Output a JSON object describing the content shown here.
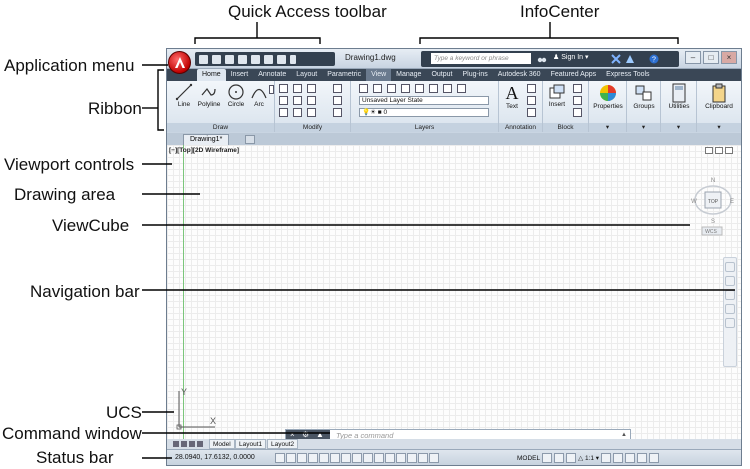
{
  "callouts": {
    "quick_access_toolbar": "Quick Access toolbar",
    "infocenter": "InfoCenter",
    "application_menu": "Application menu",
    "ribbon": "Ribbon",
    "viewport_controls": "Viewport controls",
    "drawing_area": "Drawing area",
    "viewcube": "ViewCube",
    "navigation_bar": "Navigation bar",
    "ucs": "UCS",
    "command_window": "Command window",
    "status_bar": "Status bar"
  },
  "titlebar": {
    "document_title": "Drawing1.dwg",
    "search_placeholder": "Type a keyword or phrase",
    "sign_in": "Sign In"
  },
  "ribbon_tabs": [
    "Home",
    "Insert",
    "Annotate",
    "Layout",
    "Parametric",
    "View",
    "Manage",
    "Output",
    "Plug-ins",
    "Autodesk 360",
    "Featured Apps",
    "Express Tools"
  ],
  "ribbon": {
    "draw": {
      "title": "Draw",
      "line": "Line",
      "polyline": "Polyline",
      "circle": "Circle",
      "arc": "Arc"
    },
    "modify": {
      "title": "Modify"
    },
    "layers": {
      "title": "Layers",
      "layer_state": "Unsaved Layer State",
      "current_layer": "0"
    },
    "annotation": {
      "title": "Annotation",
      "text": "Text"
    },
    "block": {
      "title": "Block",
      "insert": "Insert"
    },
    "properties": "Properties",
    "groups": "Groups",
    "utilities": "Utilities",
    "clipboard": "Clipboard"
  },
  "file_tab": "Drawing1*",
  "viewport_label": "[−][Top][2D Wireframe]",
  "viewcube": {
    "face": "TOP",
    "n": "N",
    "s": "S",
    "e": "E",
    "w": "W",
    "wcs": "WCS"
  },
  "ucs": {
    "y": "Y",
    "x": "X"
  },
  "command": {
    "placeholder": "Type a command"
  },
  "layout_tabs": [
    "Model",
    "Layout1",
    "Layout2"
  ],
  "status": {
    "coords": "28.0940, 17.6132, 0.0000",
    "model": "MODEL",
    "scale": "1:1"
  },
  "colors": {
    "accent_app_button": "#c00000",
    "dark_bar": "#33404f",
    "grid": "#dadada"
  }
}
